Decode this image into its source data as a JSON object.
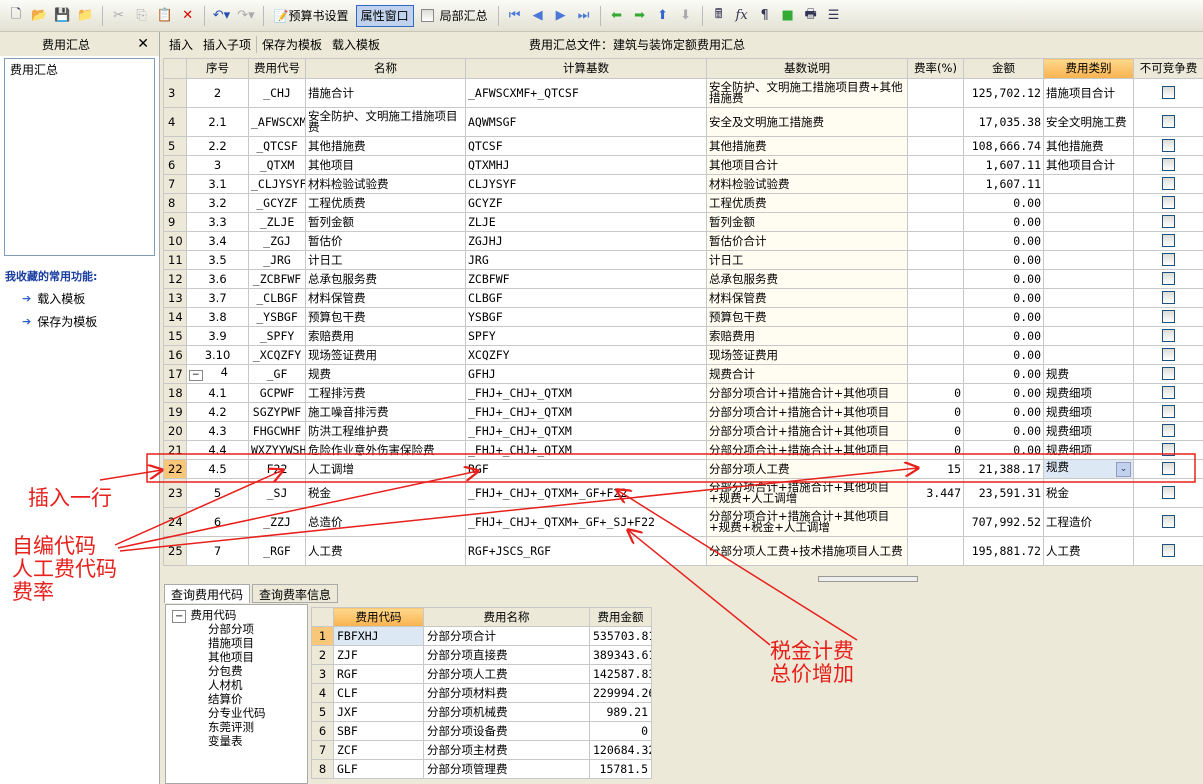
{
  "toolbar": {
    "budget_settings": "预算书设置",
    "property_window": "属性窗口",
    "partial_summary": "局部汇总"
  },
  "left_panel": {
    "title": "费用汇总",
    "close": "✕",
    "list_items": [
      "费用汇总"
    ],
    "favorites_title": "我收藏的常用功能:",
    "favorites": [
      "载入模板",
      "保存为模板"
    ]
  },
  "subbar": {
    "insert": "插入",
    "insert_child": "插入子项",
    "save_template": "保存为模板",
    "load_template": "载入模板",
    "file_title": "费用汇总文件：建筑与装饰定额费用汇总"
  },
  "grid": {
    "headers": [
      "",
      "序号",
      "费用代号",
      "名称",
      "计算基数",
      "基数说明",
      "费率(%)",
      "金额",
      "费用类别",
      "不可竞争费"
    ],
    "rows": [
      {
        "n": "3",
        "seq": "2",
        "code": "_CHJ",
        "name": "措施合计",
        "base": "_AFWSCXMF+_QTCSF",
        "desc": "安全防护、文明施工措施项目费+其他措施费",
        "rate": "",
        "amount": "125,702.12",
        "cat": "措施项目合计"
      },
      {
        "n": "4",
        "seq": "2.1",
        "code": "_AFWSCXMF",
        "name": "安全防护、文明施工措施项目费",
        "base": "AQWMSGF",
        "desc": "安全及文明施工措施费",
        "rate": "",
        "amount": "17,035.38",
        "cat": "安全文明施工费"
      },
      {
        "n": "5",
        "seq": "2.2",
        "code": "_QTCSF",
        "name": "其他措施费",
        "base": "QTCSF",
        "desc": "其他措施费",
        "rate": "",
        "amount": "108,666.74",
        "cat": "其他措施费"
      },
      {
        "n": "6",
        "seq": "3",
        "code": "_QTXM",
        "name": "其他项目",
        "base": "QTXMHJ",
        "desc": "其他项目合计",
        "rate": "",
        "amount": "1,607.11",
        "cat": "其他项目合计"
      },
      {
        "n": "7",
        "seq": "3.1",
        "code": "_CLJYSYF",
        "name": "材料检验试验费",
        "base": "CLJYSYF",
        "desc": "材料检验试验费",
        "rate": "",
        "amount": "1,607.11",
        "cat": ""
      },
      {
        "n": "8",
        "seq": "3.2",
        "code": "_GCYZF",
        "name": "工程优质费",
        "base": "GCYZF",
        "desc": "工程优质费",
        "rate": "",
        "amount": "0.00",
        "cat": ""
      },
      {
        "n": "9",
        "seq": "3.3",
        "code": "_ZLJE",
        "name": "暂列金额",
        "base": "ZLJE",
        "desc": "暂列金额",
        "rate": "",
        "amount": "0.00",
        "cat": ""
      },
      {
        "n": "10",
        "seq": "3.4",
        "code": "_ZGJ",
        "name": "暂估价",
        "base": "ZGJHJ",
        "desc": "暂估价合计",
        "rate": "",
        "amount": "0.00",
        "cat": ""
      },
      {
        "n": "11",
        "seq": "3.5",
        "code": "_JRG",
        "name": "计日工",
        "base": "JRG",
        "desc": "计日工",
        "rate": "",
        "amount": "0.00",
        "cat": ""
      },
      {
        "n": "12",
        "seq": "3.6",
        "code": "_ZCBFWF",
        "name": "总承包服务费",
        "base": "ZCBFWF",
        "desc": "总承包服务费",
        "rate": "",
        "amount": "0.00",
        "cat": ""
      },
      {
        "n": "13",
        "seq": "3.7",
        "code": "_CLBGF",
        "name": "材料保管费",
        "base": "CLBGF",
        "desc": "材料保管费",
        "rate": "",
        "amount": "0.00",
        "cat": ""
      },
      {
        "n": "14",
        "seq": "3.8",
        "code": "_YSBGF",
        "name": "预算包干费",
        "base": "YSBGF",
        "desc": "预算包干费",
        "rate": "",
        "amount": "0.00",
        "cat": ""
      },
      {
        "n": "15",
        "seq": "3.9",
        "code": "_SPFY",
        "name": "索赔费用",
        "base": "SPFY",
        "desc": "索赔费用",
        "rate": "",
        "amount": "0.00",
        "cat": ""
      },
      {
        "n": "16",
        "seq": "3.10",
        "code": "_XCQZFY",
        "name": "现场签证费用",
        "base": "XCQZFY",
        "desc": "现场签证费用",
        "rate": "",
        "amount": "0.00",
        "cat": ""
      },
      {
        "n": "17",
        "seq": "4",
        "code": "_GF",
        "name": "规费",
        "base": "GFHJ",
        "desc": "规费合计",
        "rate": "",
        "amount": "0.00",
        "cat": "规费",
        "expander": "−"
      },
      {
        "n": "18",
        "seq": "4.1",
        "code": "GCPWF",
        "name": "工程排污费",
        "base": "_FHJ+_CHJ+_QTXM",
        "desc": "分部分项合计+措施合计+其他项目",
        "rate": "0",
        "amount": "0.00",
        "cat": "规费细项"
      },
      {
        "n": "19",
        "seq": "4.2",
        "code": "SGZYPWF",
        "name": "施工噪音排污费",
        "base": "_FHJ+_CHJ+_QTXM",
        "desc": "分部分项合计+措施合计+其他项目",
        "rate": "0",
        "amount": "0.00",
        "cat": "规费细项"
      },
      {
        "n": "20",
        "seq": "4.3",
        "code": "FHGCWHF",
        "name": "防洪工程维护费",
        "base": "_FHJ+_CHJ+_QTXM",
        "desc": "分部分项合计+措施合计+其他项目",
        "rate": "0",
        "amount": "0.00",
        "cat": "规费细项"
      },
      {
        "n": "21",
        "seq": "4.4",
        "code": "WXZYYWSH",
        "name": "危险作业意外伤害保险费",
        "base": "_FHJ+_CHJ+_QTXM",
        "desc": "分部分项合计+措施合计+其他项目",
        "rate": "0",
        "amount": "0.00",
        "cat": "规费细项"
      },
      {
        "n": "22",
        "seq": "4.5",
        "code": "F22",
        "name": "人工调增",
        "base": "RGF",
        "desc": "分部分项人工费",
        "rate": "15",
        "amount": "21,388.17",
        "cat": "规费",
        "current": true
      },
      {
        "n": "23",
        "seq": "5",
        "code": "_SJ",
        "name": "税金",
        "base": "_FHJ+_CHJ+_QTXM+_GF+F22",
        "desc": "分部分项合计+措施合计+其他项目+规费+人工调增",
        "rate": "3.447",
        "amount": "23,591.31",
        "cat": "税金"
      },
      {
        "n": "24",
        "seq": "6",
        "code": "_ZZJ",
        "name": "总造价",
        "base": "_FHJ+_CHJ+_QTXM+_GF+_SJ+F22",
        "desc": "分部分项合计+措施合计+其他项目+规费+税金+人工调增",
        "rate": "",
        "amount": "707,992.52",
        "cat": "工程造价"
      },
      {
        "n": "25",
        "seq": "7",
        "code": "_RGF",
        "name": "人工费",
        "base": "RGF+JSCS_RGF",
        "desc": "分部分项人工费+技术措施项目人工费",
        "rate": "",
        "amount": "195,881.72",
        "cat": "人工费"
      }
    ]
  },
  "bottom": {
    "tabs": [
      "查询费用代码",
      "查询费率信息"
    ],
    "tree_root": "费用代码",
    "tree_items": [
      "分部分项",
      "措施项目",
      "其他项目",
      "分包费",
      "人材机",
      "结算价",
      "分专业代码",
      "东莞评测",
      "变量表"
    ],
    "headers": [
      "",
      "费用代码",
      "费用名称",
      "费用金额"
    ],
    "rows": [
      {
        "n": "1",
        "code": "FBFXHJ",
        "name": "分部分项合计",
        "amount": "535703.81"
      },
      {
        "n": "2",
        "code": "ZJF",
        "name": "分部分项直接费",
        "amount": "389343.61"
      },
      {
        "n": "3",
        "code": "RGF",
        "name": "分部分项人工费",
        "amount": "142587.83"
      },
      {
        "n": "4",
        "code": "CLF",
        "name": "分部分项材料费",
        "amount": "229994.26"
      },
      {
        "n": "5",
        "code": "JXF",
        "name": "分部分项机械费",
        "amount": "989.21"
      },
      {
        "n": "6",
        "code": "SBF",
        "name": "分部分项设备费",
        "amount": "0"
      },
      {
        "n": "7",
        "code": "ZCF",
        "name": "分部分项主材费",
        "amount": "120684.32"
      },
      {
        "n": "8",
        "code": "GLF",
        "name": "分部分项管理费",
        "amount": "15781.5"
      }
    ]
  },
  "annotations": {
    "insert_row": "插入一行",
    "custom_code": "自编代码",
    "labor_code": "人工费代码",
    "rate": "费率",
    "tax_calc": "税金计费",
    "total_increase": "总价增加",
    "color": "#e8201c"
  }
}
